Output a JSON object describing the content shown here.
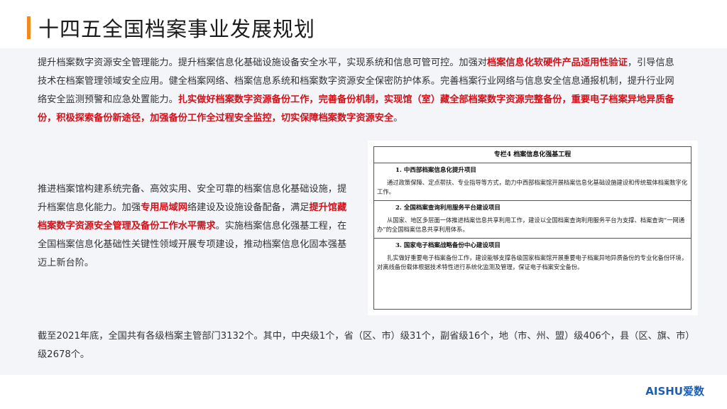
{
  "title": "十四五全国档案事业发展规划",
  "para1": [
    {
      "t": "提升档案数字资源安全管理能力。提升档案信息化基础设施设备安全水平，实现系统和信息可管可控。加强对",
      "hl": false
    },
    {
      "t": "档案信息化软硬件产品适用性验证",
      "hl": true
    },
    {
      "t": "，引导信息技术在档案管理领域安全应用。健全档案网络、档案信息系统和档案数字资源安全保密防护体系。完善档案行业网络与信息安全信息通报机制，提升行业网络安全监测预警和应急处置能力。",
      "hl": false
    },
    {
      "t": "扎实做好档案数字资源备份工作，完善备份机制，实现馆（室）藏全部档案数字资源完整备份，重要电子档案异地异质备份，积极探索备份新途径，加强备份工作全过程安全监控，切实保障档案数字资源安全",
      "hl": true
    },
    {
      "t": "。",
      "hl": false
    }
  ],
  "para2": [
    {
      "t": "推进档案馆构建系统完备、高效实用、安全可靠的档案信息化基础设施，提升档案信息化能力。加强",
      "hl": false
    },
    {
      "t": "专用局域网",
      "hl": true
    },
    {
      "t": "络建设及设施设备配备，满足",
      "hl": false
    },
    {
      "t": "提升馆藏档案数字资源安全管理及备份工作水平需求",
      "hl": true
    },
    {
      "t": "。实施档案信息化强基工程，在全国档案信息化基础性关键性领域开展专项建设，推动档案信息化固本强基迈上新台阶。",
      "hl": false
    }
  ],
  "para3": "截至2021年底，全国共有各级档案主管部门3132个。其中，中央级1个，省（区、市）级31个，副省级16个，地（市、州、盟）级406个，县（区、旗、市）级2678个。",
  "table": {
    "title": "专栏4  档案信息化强基工程",
    "sections": [
      {
        "heading": "1. 中西部档案信息化提升项目",
        "body": "通过政策保障、定点帮扶、专业指导等方式，助力中西部档案馆开展档案信息化基础设施建设和传统载体档案数字化工作。"
      },
      {
        "heading": "2. 全国档案查询利用服务平台建设项目",
        "body": "从国家、地区多层面一体推进档案信息共享利用工作，建设以全国档案查询利用服务平台为支撑、档案查询“一网通办”的全国档案信息共享利用体系。"
      },
      {
        "heading": "3. 国家电子档案战略备份中心建设项目",
        "body": "扎实做好重要电子档案备份工作，建设能够支撑各级国家档案馆开展重要电子档案异地异质备份的专业化备份环境，对离线备份载体根据技术特性进行系统化监测及管理，保证电子档案安全备份。"
      }
    ]
  },
  "logo": {
    "brand_a": "AI",
    "brand_b": "SHU",
    "brand_cn": "爱数"
  },
  "colors": {
    "accent": "#f08a1c",
    "highlight": "#d0121b",
    "content_bg": "#f3f5f9",
    "brand": "#1d5fb4"
  }
}
